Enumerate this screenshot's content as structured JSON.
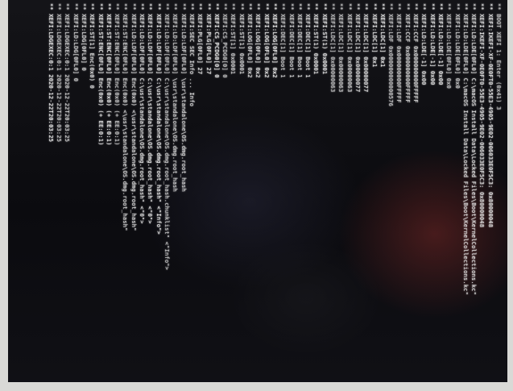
{
  "photo": {
    "colors": {
      "bezel": "#d9d9d6",
      "screen_bg": "#0b0b0f",
      "text": "#eeeeee",
      "glow": "#78281f"
    },
    "log_lines": [
      "** BOOT XEFI 1: Enter (0x41) 3",
      "** XEFI:IKEFI-XF-0E0FT0-55E3-4905-9E02-006033E0F5C3: 0x80000048",
      "** XEFI:IKEFI-XF-0E0FT0-55E3-4905-9E02-006033E0F5C3: 0x80000048",
      "** XEFI:LD:LDE[0FL0] C:\\macOS Install Data\\Locked Files\\Boot\\KernelCollections.kc\"",
      "** XEFI:LD:LDE[0FL0] C:\\macOS Install Data\\Locked Files\\Boot\\KernelCollections.kc\"",
      "** XEFI:LD:LDE[0FL0] 0x0",
      "** XEFI:LD:LDE[0FL0] 0x0",
      "** XEFI:LD:LDE[-1] 0x00",
      "** XEFI:LD:LDE[-1] 0x00",
      "** XEFI:LD:LDE[-1] 0x00",
      "** XEFI:CCF 0x000000000FFFFF",
      "** XEFI:CCF 0x000000000FFFFF",
      "** XEFI:LDF 0x000000000FFFFF",
      "** XEFI:LDF 0x000000000000576",
      "** XEFI:LDC[1] 0x1",
      "** XEFI:LDC[1] 0x1",
      "** XEFI:LDC[1] 0x00000077",
      "** XEFI:LDC[1] 0x00000077",
      "** XEFI:LDC[1] 0x00000063",
      "** XEFI:LDC[1] 0x00000063",
      "** XEFI:LDC[1] 0x00000063",
      "** XEFI:ST(1) 0x0001",
      "** XEFI:ST(1) 0x0001",
      "** XEFI:DEC[1] Boot 1",
      "** XEFI:DEC[1] Boot 1",
      "** XEFI:DEC[1] Boot 1",
      "** XEFI:DEC[1] Boot 1",
      "** XEFI:LOG[0FL0] 0x2",
      "** XEFI:LOG[0FL0] 0x2",
      "** XEFI:LOG[0FL0] 0x2",
      "** XEFI:LOG[0FL0] 0x2",
      "** XEFI:ST[1] 0x0001",
      "** XEFI:ST[1] 0x0001",
      "** XEFI:CS_PCDG0[0] 0",
      "** XEFI:CS_PCDG0[0] 0",
      "** XEFI:PLG[0FL0] 27",
      "** XEFI:PLG[0FL0] 27",
      "** XEFI:SEC SEC Info ... Info",
      "** XEFI:LD:LDF[0FL0] \\usr\\standalone\\OS.dmg.root_hash",
      "** XEFI:LD:LDF[0FL0] \\usr\\standalone\\OS.dmg.root_hash",
      "** XEFI:LD:LDF[0FL0] C:\\usr\\standalone\\OS.dmg.root_hash.chunklist\" <\"Info\">",
      "** XEFI:LD:LDF[0FL0] C:\\usr\\standalone\\OS.dmg.root_hash\" <\"Info\">",
      "** XEFI:LD:LDF[0FL0] C:\\usr\\standalone\\OS.dmg.root_hash\" <\"0\">",
      "** XEFI:LD:LDF[0FL0] C:\\usr\\standalone\\OS.dmg.root_hash\" <\"0\">",
      "** XEFI:LD:LDF[0FL0] Enc(0x0) <\\usr\\standalone\\OS.dmg.root_hash\"",
      "** XEFI:ST:ENC[0FL0] Enc(0x0) <\\usr\\standalone\\OS.dmg.root_hash\"",
      "** XEFI:ST:ENC[0FL0] Enc(0x0) (+ EE:0:1)",
      "** XEFI:ST:ENC[0FL0] Enc(0x0) (+ EE:0:1)",
      "** XEFI:ST:ENC[0FL0] Enc(0x0) (+ EE:0:1)",
      "** XEFI:ST[1] Enc(0x0) 0",
      "** XEFI:LDG[0FL0] 0",
      "** XEFI:LD:LDG[0FL0] 0",
      "** XEFI:LDGEXEC:0:1 2020-12-22T20:03:25",
      "** XEFI:LDGEXEC:0:1 2020-12-22T20:03:25",
      "** XEFI:LDGEXEC:0:1 2020-12-22T20:03:25"
    ]
  }
}
